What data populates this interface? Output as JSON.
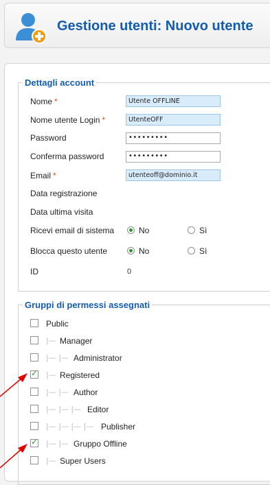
{
  "header": {
    "title": "Gestione utenti: Nuovo utente",
    "icon": "user-add-icon"
  },
  "account": {
    "legend": "Dettagli account",
    "name_label": "Nome",
    "name_value": "Utente OFFLINE",
    "login_label": "Nome utente Login",
    "login_value": "UtenteOFF",
    "password_label": "Password",
    "password_value": "•••••••••",
    "confirm_label": "Conferma password",
    "confirm_value": "•••••••••",
    "email_label": "Email",
    "email_value": "utenteoff@dominio.it",
    "registered_label": "Data registrazione",
    "lastvisit_label": "Data ultima visita",
    "sysmail_label": "Ricevi email di sistema",
    "block_label": "Blocca questo utente",
    "no_label": "No",
    "yes_label": "Sì",
    "sysmail_selected": "No",
    "block_selected": "No",
    "id_label": "ID",
    "id_value": "0",
    "required_mark": "*"
  },
  "groups": {
    "legend": "Gruppi di permessi assegnati",
    "items": [
      {
        "label": "Public",
        "checked": false,
        "tree": ""
      },
      {
        "label": "Manager",
        "checked": false,
        "tree": "|—"
      },
      {
        "label": "Administrator",
        "checked": false,
        "tree": "|— |—"
      },
      {
        "label": "Registered",
        "checked": true,
        "tree": "|—"
      },
      {
        "label": "Author",
        "checked": false,
        "tree": "|— |—"
      },
      {
        "label": "Editor",
        "checked": false,
        "tree": "|— |— |—"
      },
      {
        "label": "Publisher",
        "checked": false,
        "tree": "|— |— |— |—"
      },
      {
        "label": "Gruppo Offline",
        "checked": true,
        "tree": "|— |—"
      },
      {
        "label": "Super Users",
        "checked": false,
        "tree": "|—"
      }
    ]
  },
  "colors": {
    "accent": "#135cae",
    "required": "#d9531e",
    "check": "#2a9a2a",
    "arrow": "#e00000"
  }
}
